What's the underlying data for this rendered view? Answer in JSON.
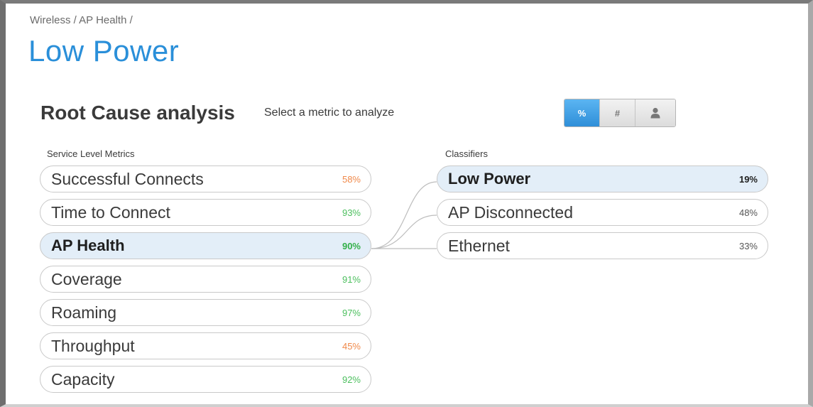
{
  "breadcrumb": "Wireless / AP Health /",
  "page_title": "Low Power",
  "section": {
    "title": "Root Cause analysis",
    "subtitle": "Select a metric to analyze"
  },
  "view_toggle": [
    {
      "label": "%",
      "icon": "percent-icon",
      "active": true
    },
    {
      "label": "#",
      "icon": "hash-icon",
      "active": false
    },
    {
      "label": "",
      "icon": "user-icon",
      "active": false
    }
  ],
  "metrics_header": "Service Level Metrics",
  "classifiers_header": "Classifiers",
  "metrics": [
    {
      "label": "Successful Connects",
      "value": "58%",
      "color": "#f0894a",
      "selected": false
    },
    {
      "label": "Time to Connect",
      "value": "93%",
      "color": "#4cbf5e",
      "selected": false
    },
    {
      "label": "AP Health",
      "value": "90%",
      "color": "#34b04a",
      "selected": true
    },
    {
      "label": "Coverage",
      "value": "91%",
      "color": "#4cbf5e",
      "selected": false
    },
    {
      "label": "Roaming",
      "value": "97%",
      "color": "#4cbf5e",
      "selected": false
    },
    {
      "label": "Throughput",
      "value": "45%",
      "color": "#f0894a",
      "selected": false
    },
    {
      "label": "Capacity",
      "value": "92%",
      "color": "#4cbf5e",
      "selected": false
    }
  ],
  "classifiers": [
    {
      "label": "Low Power",
      "value": "19%",
      "color": "#1f1f1f",
      "selected": true
    },
    {
      "label": "AP Disconnected",
      "value": "48%",
      "color": "#555555",
      "selected": false
    },
    {
      "label": "Ethernet",
      "value": "33%",
      "color": "#555555",
      "selected": false
    }
  ],
  "colors": {
    "accent": "#2a8fd9",
    "selected_bg": "#e3eef8",
    "good": "#4cbf5e",
    "warn": "#f0894a"
  }
}
